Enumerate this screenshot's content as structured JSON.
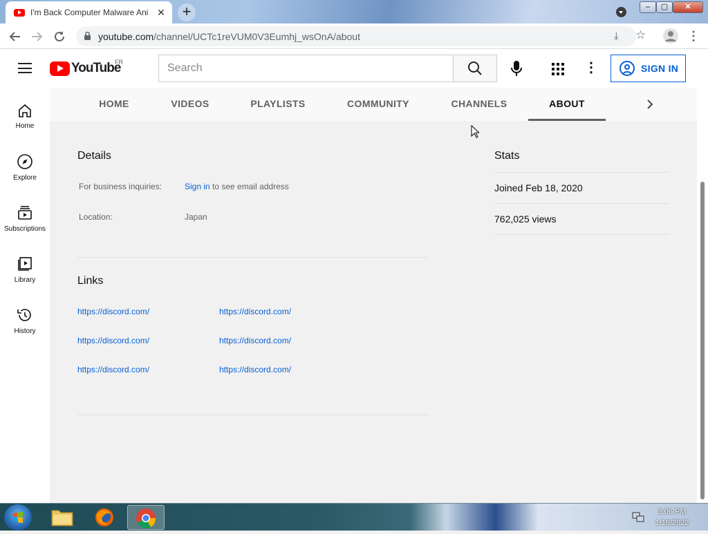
{
  "browser": {
    "tab_title": "I'm Back Computer Malware Ani",
    "tab_close": "✕",
    "new_tab": "+",
    "url_host": "youtube.com",
    "url_path": "/channel/UCTc1reVUM0V3Eumhj_wsOnA/about",
    "window_minimize": "–",
    "window_maximize": "▢",
    "window_close": "✕"
  },
  "masthead": {
    "logo_text": "YouTube",
    "country_code": "FR",
    "search_placeholder": "Search",
    "signin_label": "SIGN IN"
  },
  "guide": {
    "items": [
      {
        "label": "Home",
        "icon": "home-icon"
      },
      {
        "label": "Explore",
        "icon": "compass-icon"
      },
      {
        "label": "Subscriptions",
        "icon": "subscriptions-icon"
      },
      {
        "label": "Library",
        "icon": "library-icon"
      },
      {
        "label": "History",
        "icon": "history-icon"
      }
    ]
  },
  "channel_tabs": {
    "items": [
      "HOME",
      "VIDEOS",
      "PLAYLISTS",
      "COMMUNITY",
      "CHANNELS",
      "ABOUT"
    ],
    "active": "ABOUT"
  },
  "details": {
    "title": "Details",
    "business_label": "For business inquiries:",
    "business_link": "Sign in",
    "business_suffix": " to see email address",
    "location_label": "Location:",
    "location_value": "Japan"
  },
  "links": {
    "title": "Links",
    "items": [
      "https://discord.com/",
      "https://discord.com/",
      "https://discord.com/",
      "https://discord.com/",
      "https://discord.com/",
      "https://discord.com/"
    ]
  },
  "stats": {
    "title": "Stats",
    "joined": "Joined Feb 18, 2020",
    "views": "762,025 views"
  },
  "taskbar": {
    "time": "3:06 PM",
    "date": "1/18/2022"
  },
  "colors": {
    "accent_blue": "#065fd4",
    "youtube_red": "#ff0000"
  }
}
